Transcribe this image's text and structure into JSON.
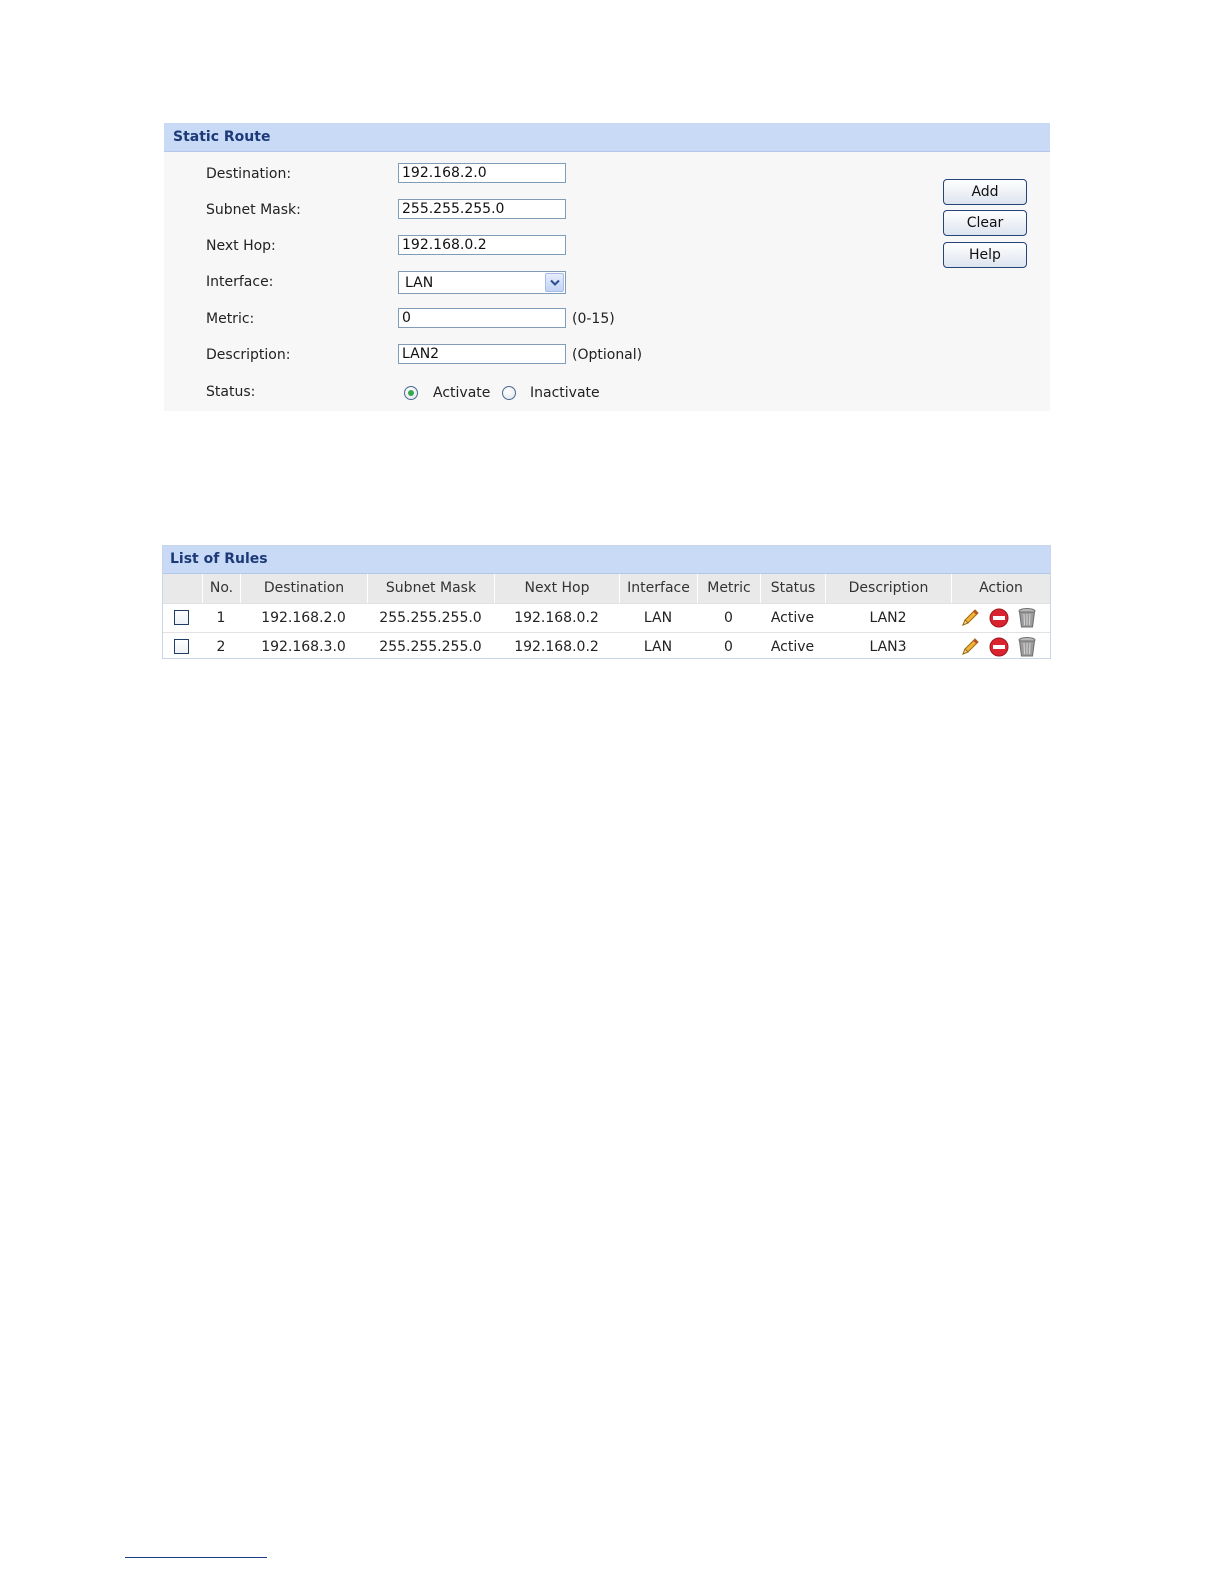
{
  "static_route": {
    "title": "Static Route",
    "fields": {
      "destination": {
        "label": "Destination:",
        "value": "192.168.2.0"
      },
      "subnet_mask": {
        "label": "Subnet Mask:",
        "value": "255.255.255.0"
      },
      "next_hop": {
        "label": "Next Hop:",
        "value": "192.168.0.2"
      },
      "interface": {
        "label": "Interface:",
        "value": "LAN"
      },
      "metric": {
        "label": "Metric:",
        "value": "0",
        "hint": "(0-15)"
      },
      "description": {
        "label": "Description:",
        "value": "LAN2",
        "hint": "(Optional)"
      },
      "status": {
        "label": "Status:",
        "options": [
          "Activate",
          "Inactivate"
        ],
        "selected": "Activate"
      }
    },
    "buttons": {
      "add": "Add",
      "clear": "Clear",
      "help": "Help"
    }
  },
  "rules_list": {
    "title": "List of Rules",
    "columns": [
      "No.",
      "Destination",
      "Subnet Mask",
      "Next Hop",
      "Interface",
      "Metric",
      "Status",
      "Description",
      "Action"
    ],
    "rows": [
      {
        "no": "1",
        "destination": "192.168.2.0",
        "subnet_mask": "255.255.255.0",
        "next_hop": "192.168.0.2",
        "interface": "LAN",
        "metric": "0",
        "status": "Active",
        "description": "LAN2"
      },
      {
        "no": "2",
        "destination": "192.168.3.0",
        "subnet_mask": "255.255.255.0",
        "next_hop": "192.168.0.2",
        "interface": "LAN",
        "metric": "0",
        "status": "Active",
        "description": "LAN3"
      }
    ],
    "action_icons": [
      "pencil-icon",
      "stop-icon",
      "trash-icon"
    ]
  },
  "colors": {
    "header_bg": "#c9daf7",
    "header_text": "#1c3a78",
    "radio_checked": "#35a94a",
    "table_header_bg": "#e9e9e9"
  }
}
